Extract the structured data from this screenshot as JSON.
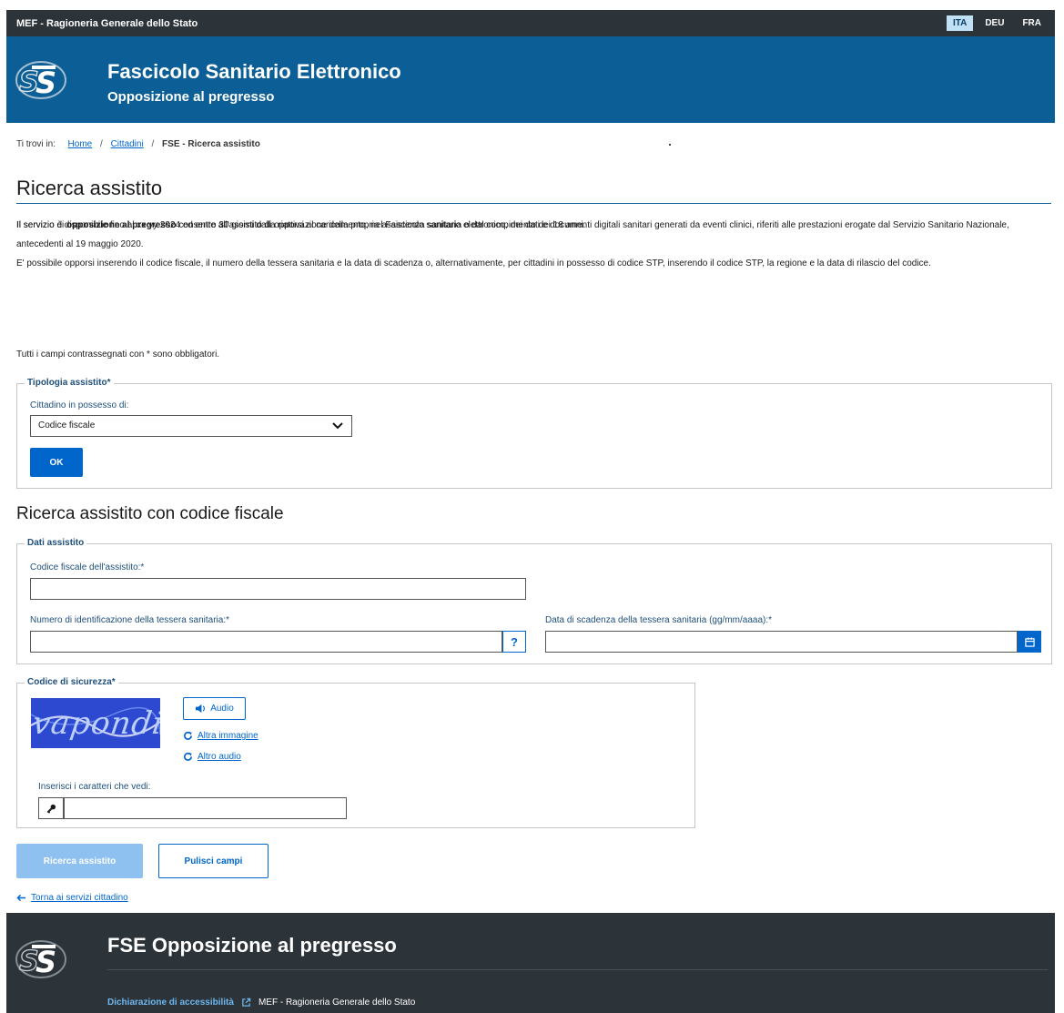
{
  "topbar": {
    "org": "MEF - Ragioneria Generale dello Stato",
    "languages": [
      "ITA",
      "DEU",
      "FRA"
    ],
    "active_language": "ITA"
  },
  "header": {
    "logo_text": "STS",
    "title": "Fascicolo Sanitario Elettronico",
    "subtitle": "Opposizione al pregresso"
  },
  "breadcrumb": {
    "prefix": "Ti trovi in:",
    "items": [
      "Home",
      "Cittadini"
    ],
    "current": "FSE - Ricerca assistito"
  },
  "page_title": "Ricerca assistito",
  "intro": {
    "p1_before": "Il servizio di ",
    "p1_bold": "opposizione al pregresso",
    "p1_after": " consente all'assistito di opporsi al caricamento, nel Fascicolo sanitario elettronico, dei dati e documenti digitali sanitari generati da eventi clinici, riferiti alle prestazioni erogate dal Servizio Sanitario Nazionale, antecedenti al 19 maggio 2020.",
    "p2": "E' possibile opporsi inserendo il codice fiscale, il numero della tessera sanitaria e la data di scadenza o, alternativamente, per cittadini in possesso di codice STP, inserendo il codice STP, la regione e la data di rilascio del codice.",
    "availability": "Il servizio è disponibile fino al xx yy 2024 ed entro 30 giorni dalla riattivazione della propria assistenza sanitaria o dal compimento dei 18 anni.",
    "required_note": "Tutti i campi contrassegnati con * sono obbligatori."
  },
  "tipologia": {
    "legend": "Tipologia assistito*",
    "select_label": "Cittadino in possesso di:",
    "select_value": "Codice fiscale",
    "ok_label": "OK"
  },
  "section_title": "Ricerca assistito con codice fiscale",
  "dati": {
    "legend": "Dati assistito",
    "cf_label": "Codice fiscale dell'assistito:*",
    "cf_value": "",
    "tessera_label": "Numero di identificazione della tessera sanitaria:*",
    "tessera_help": "?",
    "scadenza_label": "Data di scadenza della tessera sanitaria (gg/mm/aaaa):*"
  },
  "captcha": {
    "legend": "Codice di sicurezza*",
    "image_text": "vapondi",
    "audio_label": "Audio",
    "other_image": "Altra immagine",
    "other_audio": "Altro audio",
    "input_label": "Inserisci i caratteri che vedi:"
  },
  "actions": {
    "search_label": "Ricerca assistito",
    "clear_label": "Pulisci campi",
    "back_label": "Torna ai servizi cittadino"
  },
  "footer": {
    "title": "FSE Opposizione al pregresso",
    "accessibility": "Dichiarazione di accessibilità",
    "org": "MEF - Ragioneria Generale dello Stato"
  },
  "colors": {
    "header_blue": "#0b5f96",
    "dark_bar": "#2c3339",
    "primary": "#0066cc",
    "primary_disabled": "#8ec1ef"
  }
}
